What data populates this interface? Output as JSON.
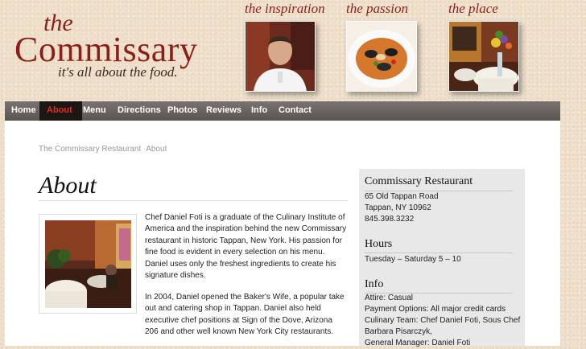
{
  "logo": {
    "the": "the",
    "name": "Commissary",
    "tagline": "it's all about the food."
  },
  "header_photos": [
    {
      "caption": "the inspiration"
    },
    {
      "caption": "the passion"
    },
    {
      "caption": "the place"
    }
  ],
  "nav": {
    "items": [
      {
        "label": "Home"
      },
      {
        "label": "About",
        "active": true
      },
      {
        "label": "Menu"
      },
      {
        "label": "Directions"
      },
      {
        "label": "Photos"
      },
      {
        "label": "Reviews"
      },
      {
        "label": "Info"
      },
      {
        "label": "Contact"
      }
    ]
  },
  "breadcrumb": {
    "home": "The Commissary Restaurant",
    "current": "About"
  },
  "page": {
    "title": "About",
    "paragraph1": "Chef Daniel Foti is a graduate of the Culinary Institute of America and the inspiration behind the new Commissary restaurant in historic Tappan, New York. His passion for fine food is evident in every selection on his menu. Daniel uses only the freshest ingredients to create his signature dishes.",
    "paragraph2": "In 2004, Daniel opened the Baker's Wife, a popular take out and catering shop in Tappan. Daniel also held executive chef positions at Sign of the Dove, Arizona 206 and other well known New York City restaurants."
  },
  "sidebar": {
    "restaurant": {
      "heading": "Commissary Restaurant",
      "street": "65 Old Tappan Road",
      "city": "Tappan, NY 10962",
      "phone": "845.398.3232"
    },
    "hours": {
      "heading": "Hours",
      "text": "Tuesday – Saturday 5 – 10"
    },
    "info": {
      "heading": "Info",
      "attire": "Attire: Casual",
      "payment": "Payment Options: All major credit cards",
      "team1": "Culinary Team: Chef Daniel Foti, Sous Chef",
      "team2": "Barbara Pisarczyk,",
      "manager": "General Manager: Daniel Foti"
    }
  },
  "colors": {
    "brand_red": "#8a1f1a",
    "nav_bg": "#5f5955",
    "nav_active_bg": "#1c1614",
    "nav_active_text": "#e0301e"
  }
}
